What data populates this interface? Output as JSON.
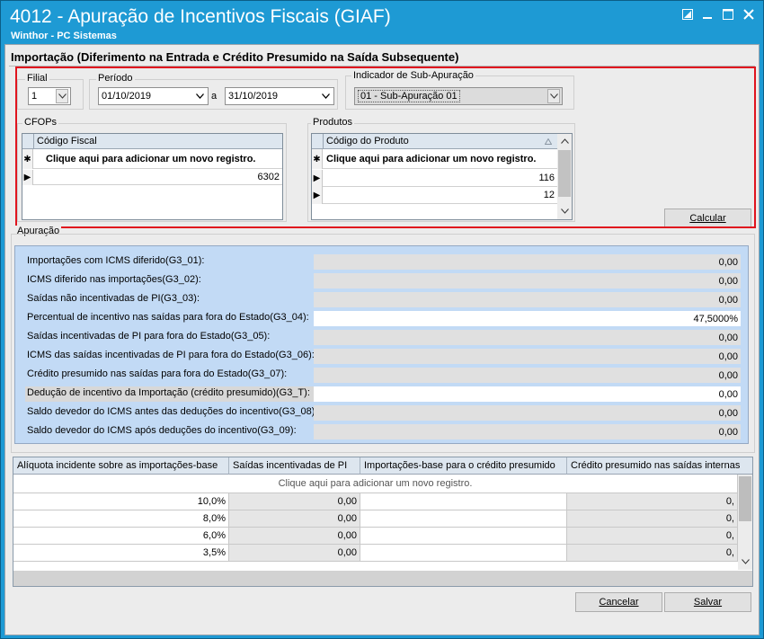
{
  "window": {
    "title": "4012 - Apuração de Incentivos Fiscais (GIAF)",
    "subtitle": "Winthor - PC Sistemas"
  },
  "heading": "Importação (Diferimento na Entrada e Crédito Presumido na Saída Subsequente)",
  "filial": {
    "label": "Filial",
    "value": "1"
  },
  "periodo": {
    "label": "Período",
    "start": "01/10/2019",
    "separator": "a",
    "end": "31/10/2019"
  },
  "sub_apuracao": {
    "label": "Indicador de Sub-Apuração",
    "value": "01 - Sub-Apuração 01"
  },
  "cfops": {
    "label": "CFOPs",
    "column": "Código Fiscal",
    "add_new": "Clique aqui para adicionar um novo registro.",
    "rows": [
      "6302"
    ]
  },
  "produtos": {
    "label": "Produtos",
    "column": "Código do Produto",
    "add_new": "Clique aqui para adicionar um novo registro.",
    "rows": [
      "116",
      "12"
    ]
  },
  "calcular_label": "Calcular",
  "apuracao": {
    "label": "Apuração",
    "rows": [
      {
        "label": "Importações com ICMS diferido(G3_01):",
        "value": "0,00"
      },
      {
        "label": "ICMS diferido nas importações(G3_02):",
        "value": "0,00"
      },
      {
        "label": "Saídas não incentivadas de PI(G3_03):",
        "value": "0,00"
      },
      {
        "label": "Percentual de incentivo nas saídas para fora do Estado(G3_04):",
        "value": "47,5000%"
      },
      {
        "label": "Saídas incentivadas de PI para fora do Estado(G3_05):",
        "value": "0,00"
      },
      {
        "label": "ICMS das saídas incentivadas de PI para fora do Estado(G3_06):",
        "value": "0,00"
      },
      {
        "label": "Crédito presumido nas saídas para fora do Estado(G3_07):",
        "value": "0,00"
      },
      {
        "label": "Dedução de incentivo da Importação (crédito presumido)(G3_T):",
        "value": "0,00"
      },
      {
        "label": "Saldo devedor do ICMS antes das deduções do incentivo(G3_08):",
        "value": "0,00"
      },
      {
        "label": "Saldo devedor do ICMS após deduções do incentivo(G3_09):",
        "value": "0,00"
      }
    ]
  },
  "aliquotas": {
    "columns": [
      "Alíquota incidente sobre as importações-base",
      "Saídas incentivadas de PI",
      "Importações-base para o crédito presumido",
      "Crédito presumido nas saídas internas"
    ],
    "add_new": "Clique aqui para adicionar um novo registro.",
    "rows": [
      [
        "10,0%",
        "0,00",
        "",
        "0,"
      ],
      [
        "8,0%",
        "0,00",
        "",
        "0,"
      ],
      [
        "6,0%",
        "0,00",
        "",
        "0,"
      ],
      [
        "3,5%",
        "0,00",
        "",
        "0,"
      ]
    ]
  },
  "buttons": {
    "cancelar": "Cancelar",
    "salvar": "Salvar"
  }
}
